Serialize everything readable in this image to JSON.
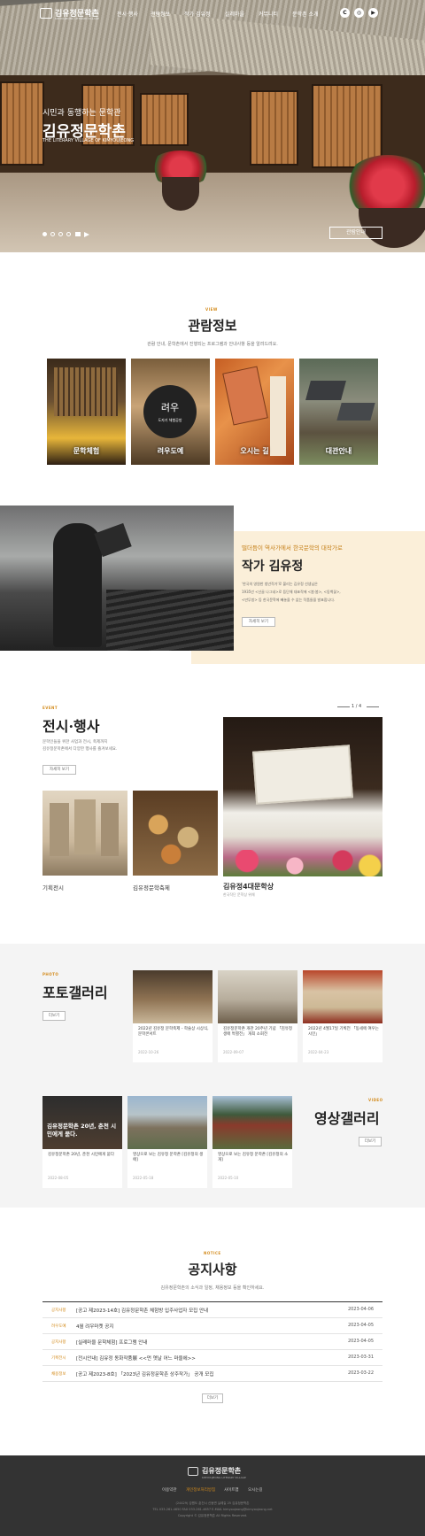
{
  "header": {
    "logo_text": "김유정문학촌",
    "logo_sub": "KIMYOUJEONG LITERARY VILLAGE",
    "nav": [
      "전시·행사",
      "관람정보",
      "작가 김유정",
      "실레마을",
      "커뮤니티",
      "문학촌 소개"
    ],
    "sns": [
      {
        "icon": "chuncheon-icon",
        "glyph": "C"
      },
      {
        "icon": "instagram-icon",
        "glyph": "◎"
      },
      {
        "icon": "youtube-icon",
        "glyph": "▶"
      }
    ]
  },
  "hero": {
    "kicker": "시민과 동행하는 문학관",
    "title": "김유정문학촌",
    "subtitle": "THE LITERARY VILLAGE OF KIMYOUJEONG",
    "button": "관람안내"
  },
  "view": {
    "kicker": "VIEW",
    "title": "관람정보",
    "desc": "관람 안내, 문학촌에서 진행되는 프로그램과 안내사항 등을 알려드려요.",
    "cards": [
      "문학체험",
      "려우도예",
      "오시는 길",
      "대관안내"
    ],
    "sign_text": "려우",
    "sign_sub": "도자기 체험공방"
  },
  "writer": {
    "en": "KIMYOUJEONG",
    "kicker": "떨더듬이 역사가에서 한국문학의 대작가로",
    "title": "작가 김유정",
    "paras": [
      "'한국의 영원한 청년작가'로 불리는 김유정 선생님은",
      "1935년 <산골 나그네>로 등단해 대표작에 <봄·봄>, <동백꽃>,",
      "<만무방> 등 한국문학에 빼놓을 수 없는 작품들을 발표합니다."
    ],
    "button": "자세히 보기"
  },
  "event": {
    "kicker": "EVENT",
    "title": "전시·행사",
    "desc": [
      "문학인들을 위한 사업과 전시, 축제까지",
      "김유정문학촌에서 다양한 행사를 즐겨보세요."
    ],
    "button": "자세히 보기",
    "pager": "1 / 4",
    "items": [
      "기획전시",
      "김유정문학축제"
    ],
    "feature_title": "김유정4대문학상",
    "feature_sub": "한국작단 문학상 위해"
  },
  "photo": {
    "kicker": "PHOTO",
    "title": "포토갤러리",
    "button": "더보기",
    "cards": [
      {
        "title": "2022년 김유정 문학축제 - 학술상 시상식, 문학콘서트",
        "date": "2022-10-26"
      },
      {
        "title": "김유정문학촌 개관 20주년 기념 「김유정 생애 특별전」 개최 소회전",
        "date": "2022-09-07"
      },
      {
        "title": "2022년 4월17일 기획전 「동세에 여우는 시인」",
        "date": "2022-04-23"
      }
    ]
  },
  "video": {
    "kicker": "VIDEO",
    "title": "영상갤러리",
    "button": "더보기",
    "thumb_caption": "김유정문학촌 20년, 춘천 시민에게 묻다.",
    "cards": [
      {
        "title": "김유정문학촌 20년, 춘천 시민에게 묻다",
        "date": "2022-08-05"
      },
      {
        "title": "영상으로 보는 김유정 문학촌 [김유정의 생애]",
        "date": "2022-05-18"
      },
      {
        "title": "영상으로 보는 김유정 문학촌 [김유정의 소개]",
        "date": "2022-05-10"
      }
    ]
  },
  "notice": {
    "kicker": "NOTICE",
    "title": "공지사항",
    "desc": "김유정문학촌의 소식과 일정, 채용정보 등을 확인하세요.",
    "button": "더보기",
    "rows": [
      {
        "tag": "공지사항",
        "title": "[공고 제2023-14호] 김유정문학촌 체험방 입주사업자 모집 안내",
        "date": "2023-04-06"
      },
      {
        "tag": "려우도예",
        "title": "4월 려우마켓 공지",
        "date": "2023-04-05"
      },
      {
        "tag": "공지사항",
        "title": "[실레마을 문학체험] 프로그램 안내",
        "date": "2023-04-05"
      },
      {
        "tag": "기획전시",
        "title": "[전시안내] 김유정 동화작품展 <<먼 옛날 어느 마을에>>",
        "date": "2023-03-31"
      },
      {
        "tag": "채용정보",
        "title": "[공고 제2023-8호] 「2023년 김유정문학촌 상주작가」 공개 모집",
        "date": "2023-03-22"
      }
    ]
  },
  "footer": {
    "logo_text": "김유정문학촌",
    "logo_sub": "KIMYOUJEONG LITERARY VILLAGE",
    "links": [
      "이용약관",
      "개인정보처리방침",
      "사이트맵",
      "오시는길"
    ],
    "info": [
      "(24429) 강원도 춘천시 신동면 실레길 25 김유정문학촌",
      "TEL 033-261-4650 FAX 033-261-4657 E-MAIL kimyoujeong@kimyoujeong.net",
      "Copyright © 김유정문학촌 All Rights Reserved."
    ],
    "highlight_color": "#d38b1c"
  }
}
